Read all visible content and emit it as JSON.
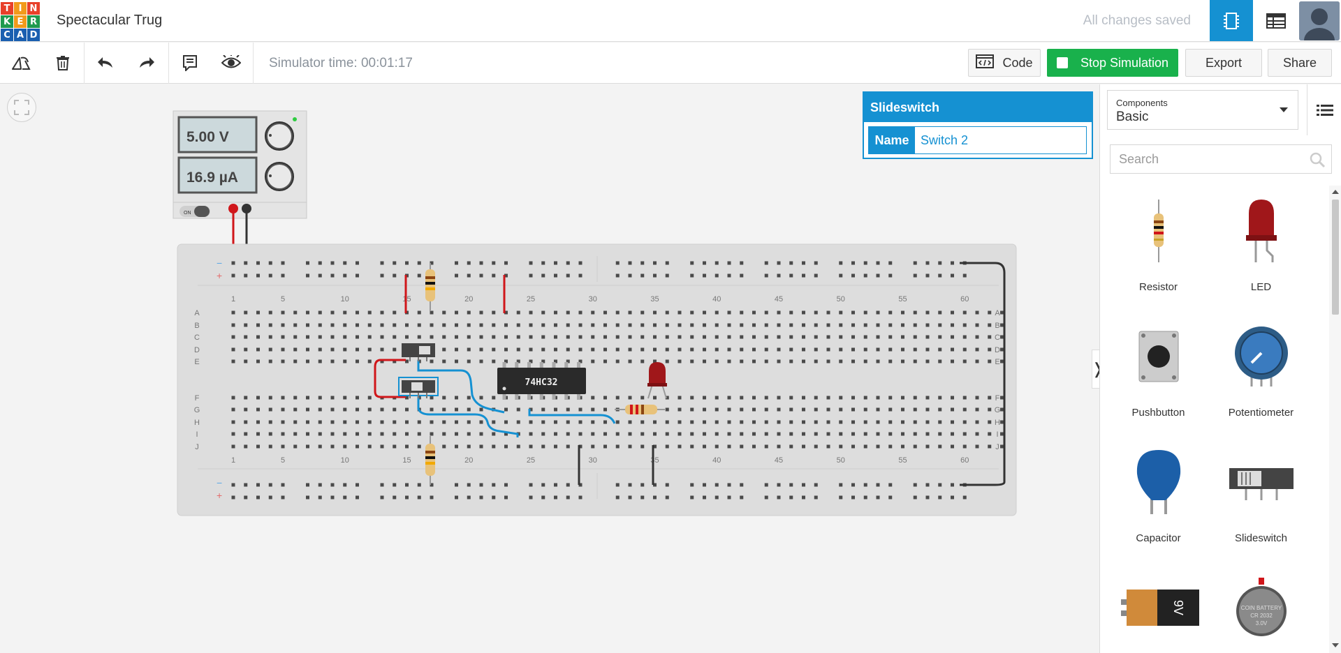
{
  "app": {
    "logo_letters": [
      "T",
      "I",
      "N",
      "K",
      "E",
      "R",
      "C",
      "A",
      "D"
    ],
    "logo_colors": [
      "#e8402a",
      "#f29a1b",
      "#e8402a",
      "#1f9a4f",
      "#f29a1b",
      "#1f9a4f",
      "#1a5fb0",
      "#1a5fb0",
      "#1a5fb0"
    ],
    "title": "Spectacular Trug",
    "save_status": "All changes saved",
    "accent": "#1591d2"
  },
  "toolbar": {
    "sim_time": "Simulator time: 00:01:17",
    "code_label": "Code",
    "stop_label": "Stop Simulation",
    "export_label": "Export",
    "share_label": "Share",
    "stop_color": "#19b14c"
  },
  "power_supply": {
    "voltage": "5.00 V",
    "current": "16.9 µA",
    "switch_label": "ON"
  },
  "breadboard": {
    "column_numbers": [
      "1",
      "5",
      "10",
      "15",
      "20",
      "25",
      "30",
      "35",
      "40",
      "45",
      "50",
      "55",
      "60"
    ],
    "row_letters_top": [
      "A",
      "B",
      "C",
      "D",
      "E"
    ],
    "row_letters_bottom": [
      "F",
      "G",
      "H",
      "I",
      "J"
    ],
    "rail_minus": "−",
    "rail_plus": "+",
    "ic_label": "74HC32"
  },
  "inspector": {
    "title": "Slideswitch",
    "name_label": "Name",
    "name_value": "Switch 2"
  },
  "panel": {
    "components_label": "Components",
    "components_value": "Basic",
    "search_placeholder": "Search",
    "items": [
      {
        "label": "Resistor",
        "icon": "resistor-icon"
      },
      {
        "label": "LED",
        "icon": "led-icon"
      },
      {
        "label": "Pushbutton",
        "icon": "pushbutton-icon"
      },
      {
        "label": "Potentiometer",
        "icon": "potentiometer-icon"
      },
      {
        "label": "Capacitor",
        "icon": "capacitor-icon"
      },
      {
        "label": "Slideswitch",
        "icon": "slideswitch-icon"
      },
      {
        "label": "",
        "icon": "battery-9v-icon"
      },
      {
        "label": "",
        "icon": "coin-battery-icon"
      }
    ],
    "battery_text": "9V",
    "coin_text_1": "COIN BATTERY",
    "coin_text_2": "CR 2032",
    "coin_text_3": "3.0V"
  }
}
